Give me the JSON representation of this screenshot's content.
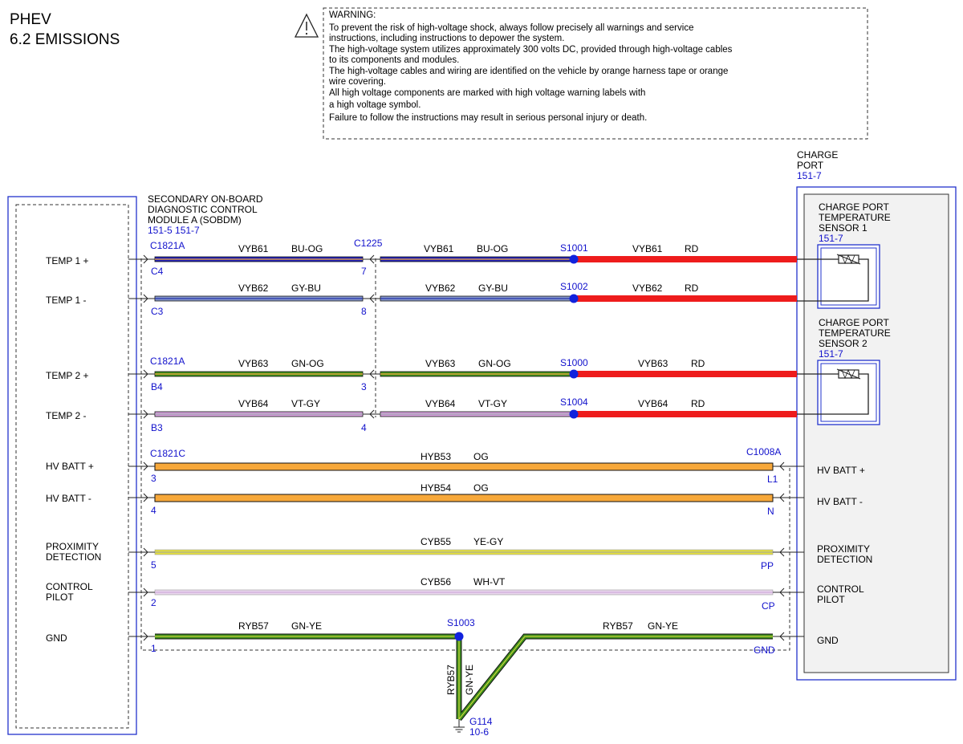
{
  "header": {
    "line1": "PHEV",
    "line2": "6.2 EMISSIONS"
  },
  "warning": {
    "title": "WARNING:",
    "lines": [
      "To prevent the risk of high-voltage shock, always follow precisely all warnings and service",
      "instructions, including instructions to depower the system.",
      "The high-voltage system utilizes approximately 300 volts DC, provided through high-voltage cables",
      "to its components and modules.",
      "The high-voltage cables and wiring are identified on the vehicle by orange harness tape or orange",
      "wire covering.",
      "All high voltage components are marked with high voltage warning labels with",
      "a high voltage symbol.",
      "Failure to follow the instructions may result in serious personal injury or death."
    ]
  },
  "module_left": {
    "name": [
      "SECONDARY ON-BOARD",
      "DIAGNOSTIC CONTROL",
      "MODULE A (SOBDM)"
    ],
    "refs": "151-5  151-7"
  },
  "charge_port": {
    "name": [
      "CHARGE",
      "PORT"
    ],
    "ref": "151-7",
    "sensor1": {
      "name": [
        "CHARGE PORT",
        "TEMPERATURE",
        "SENSOR 1"
      ],
      "ref": "151-7"
    },
    "sensor2": {
      "name": [
        "CHARGE PORT",
        "TEMPERATURE",
        "SENSOR 2"
      ],
      "ref": "151-7"
    }
  },
  "left_pins": [
    {
      "label": [
        "TEMP 1 +"
      ]
    },
    {
      "label": [
        "TEMP 1 -"
      ]
    },
    {
      "label": [
        "TEMP 2 +"
      ]
    },
    {
      "label": [
        "TEMP 2 -"
      ]
    },
    {
      "label": [
        "HV BATT +"
      ]
    },
    {
      "label": [
        "HV BATT -"
      ]
    },
    {
      "label": [
        "PROXIMITY",
        "DETECTION"
      ]
    },
    {
      "label": [
        "CONTROL",
        "PILOT"
      ]
    },
    {
      "label": [
        "GND"
      ]
    }
  ],
  "right_pins": [
    {
      "label": [
        "HV BATT +"
      ]
    },
    {
      "label": [
        "HV BATT -"
      ]
    },
    {
      "label": [
        "PROXIMITY",
        "DETECTION"
      ]
    },
    {
      "label": [
        "CONTROL",
        "PILOT"
      ]
    },
    {
      "label": [
        "GND"
      ]
    }
  ],
  "connectors": {
    "c1821a_top": "C1821A",
    "c1821a_mid": "C1821A",
    "c1821c": "C1821C",
    "c1225": "C1225",
    "c1008a": "C1008A"
  },
  "pins": {
    "left": [
      "C4",
      "C3",
      "B4",
      "B3",
      "3",
      "4",
      "5",
      "2",
      "1"
    ],
    "c1225": [
      "7",
      "8",
      "3",
      "4"
    ],
    "right": [
      "L1",
      "N",
      "PP",
      "CP",
      "GND"
    ]
  },
  "splices": {
    "s1001": "S1001",
    "s1002": "S1002",
    "s1000": "S1000",
    "s1004": "S1004",
    "s1003": "S1003"
  },
  "temp_wires": [
    {
      "circuit": "VYB61",
      "color_a": "BU-OG",
      "color_b": "BU-OG",
      "color_c": "RD"
    },
    {
      "circuit": "VYB62",
      "color_a": "GY-BU",
      "color_b": "GY-BU",
      "color_c": "RD"
    },
    {
      "circuit": "VYB63",
      "color_a": "GN-OG",
      "color_b": "GN-OG",
      "color_c": "RD"
    },
    {
      "circuit": "VYB64",
      "color_a": "VT-GY",
      "color_b": "VT-GY",
      "color_c": "RD"
    }
  ],
  "long_wires": [
    {
      "circuit": "HYB53",
      "color": "OG"
    },
    {
      "circuit": "HYB54",
      "color": "OG"
    },
    {
      "circuit": "CYB55",
      "color": "YE-GY"
    },
    {
      "circuit": "CYB56",
      "color": "WH-VT"
    }
  ],
  "gnd_wire": {
    "left_circuit": "RYB57",
    "left_color": "GN-YE",
    "right_circuit": "RYB57",
    "right_color": "GN-YE",
    "drop_circuit": "RYB57",
    "drop_color": "GN-YE",
    "ground": "G114",
    "ground_ref": "10-6"
  },
  "wire_colors": {
    "blue": "#2222bb",
    "gray": "#8899cc",
    "green": "#3f8f1f",
    "violet": "#d9a3e0",
    "red": "#ee1c1c",
    "orange": "#f7a83a",
    "yellow": "#e5e03c",
    "white_violet": "#e9d6ee",
    "ref_blue": "#1111cc"
  }
}
